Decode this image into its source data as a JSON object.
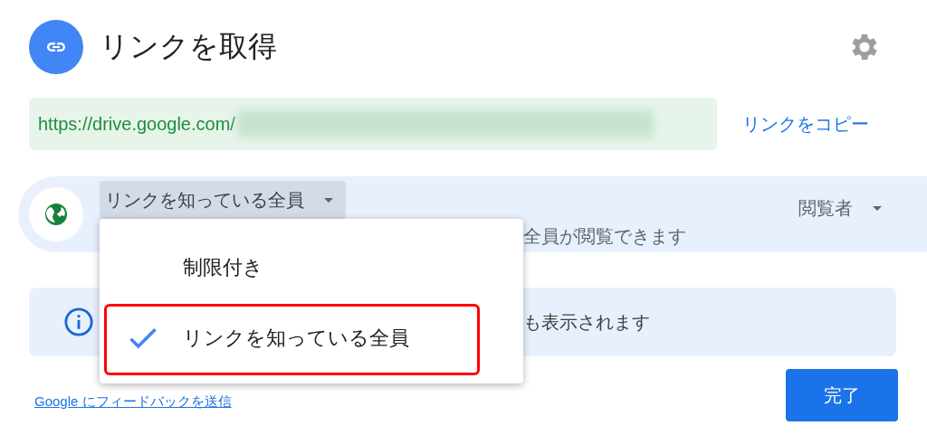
{
  "dialog": {
    "title": "リンクを取得",
    "link": {
      "url": "https://drive.google.com/",
      "action": "リンクをコピー"
    },
    "access": {
      "scope": "リンクを知っている全員",
      "description": "全員が閲覧できます",
      "role": "閲覧者"
    },
    "notice": {
      "text": "も表示されます"
    },
    "feedback": "Google にフィードバックを送信",
    "done": "完了"
  },
  "menu": {
    "items": [
      {
        "label": "制限付き",
        "selected": false,
        "highlighted": false
      },
      {
        "label": "リンクを知っている全員",
        "selected": true,
        "highlighted": true
      }
    ]
  }
}
